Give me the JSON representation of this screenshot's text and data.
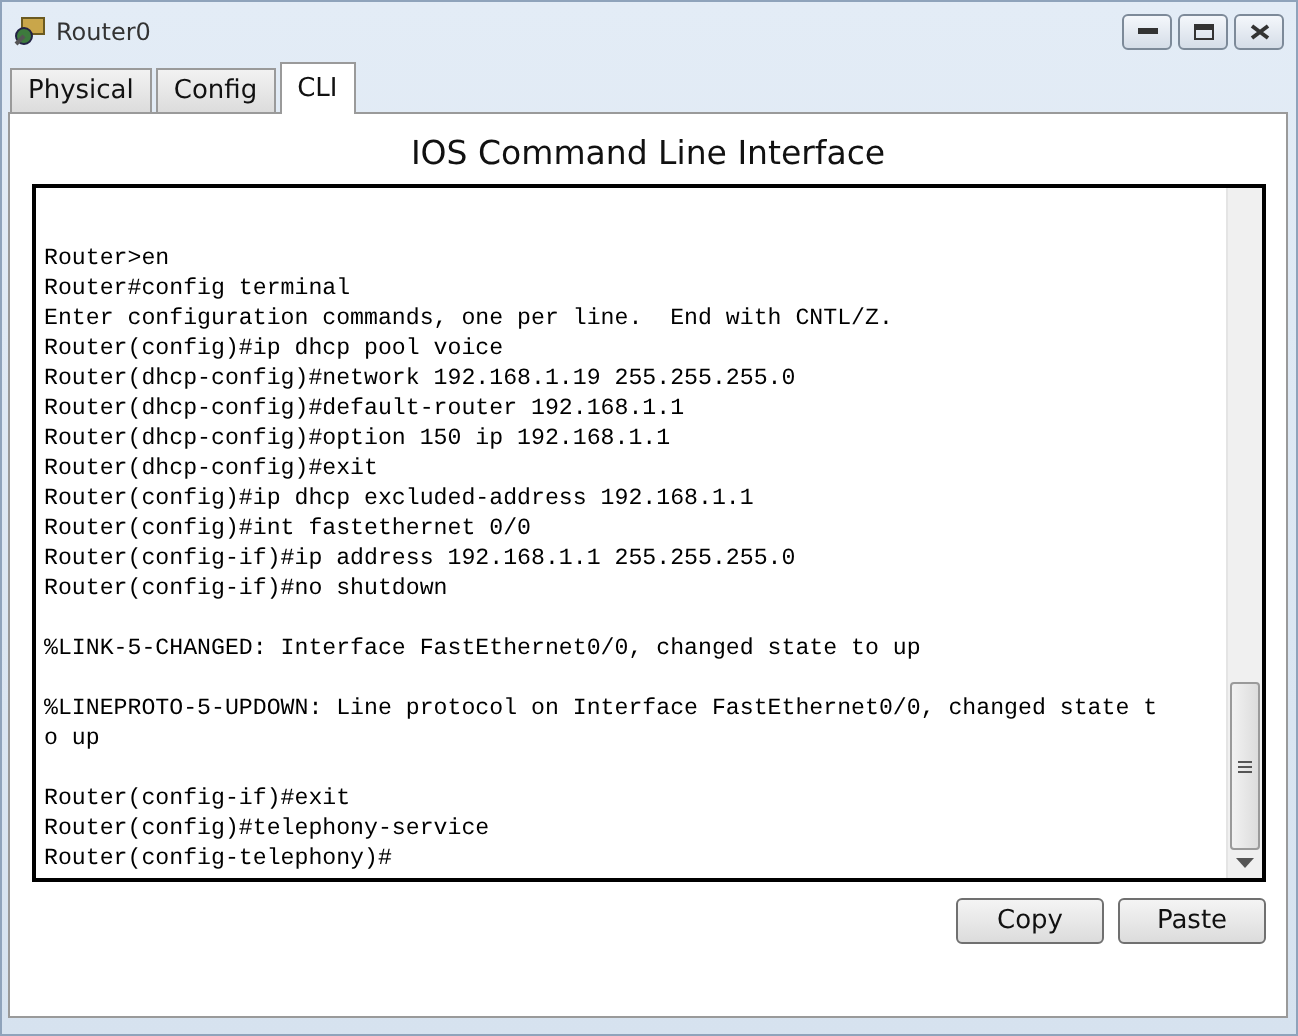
{
  "window": {
    "title": "Router0"
  },
  "tabs": [
    {
      "label": "Physical",
      "selected": false
    },
    {
      "label": "Config",
      "selected": false
    },
    {
      "label": "CLI",
      "selected": true
    }
  ],
  "heading": "IOS Command Line Interface",
  "terminal": {
    "blocks": [
      [
        "Router>en",
        "Router#config terminal",
        "Enter configuration commands, one per line.  End with CNTL/Z.",
        "Router(config)#ip dhcp pool voice",
        "Router(dhcp-config)#network 192.168.1.19 255.255.255.0",
        "Router(dhcp-config)#default-router 192.168.1.1",
        "Router(dhcp-config)#option 150 ip 192.168.1.1",
        "Router(dhcp-config)#exit",
        "Router(config)#ip dhcp excluded-address 192.168.1.1",
        "Router(config)#int fastethernet 0/0",
        "Router(config-if)#ip address 192.168.1.1 255.255.255.0",
        "Router(config-if)#no shutdown"
      ],
      [
        "%LINK-5-CHANGED: Interface FastEthernet0/0, changed state to up"
      ],
      [
        "%LINEPROTO-5-UPDOWN: Line protocol on Interface FastEthernet0/0, changed state t",
        "o up"
      ],
      [
        "Router(config-if)#exit",
        "Router(config)#telephony-service",
        "Router(config-telephony)#"
      ]
    ]
  },
  "buttons": [
    "Copy",
    "Paste"
  ]
}
